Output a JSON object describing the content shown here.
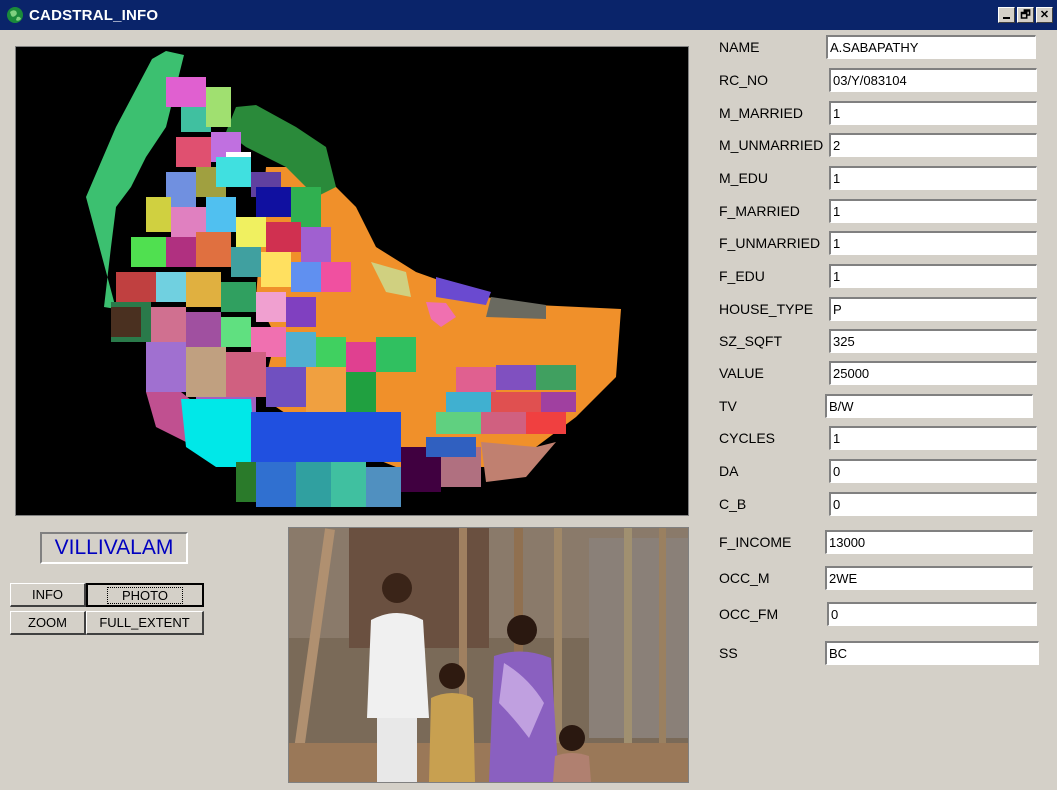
{
  "window": {
    "title": "CADSTRAL_INFO",
    "restore_glyph": "🗗",
    "close_glyph": "✕"
  },
  "village": {
    "name": "VILLIVALAM"
  },
  "buttons": {
    "info": "INFO",
    "photo": "PHOTO",
    "zoom": "ZOOM",
    "full_extent": "FULL_EXTENT"
  },
  "fields": [
    {
      "label": "NAME",
      "value": "A.SABAPATHY"
    },
    {
      "label": "RC_NO",
      "value": "03/Y/083104"
    },
    {
      "label": "M_MARRIED",
      "value": "1"
    },
    {
      "label": "M_UNMARRIED",
      "value": "2"
    },
    {
      "label": "M_EDU",
      "value": "1"
    },
    {
      "label": "F_MARRIED",
      "value": "1"
    },
    {
      "label": "F_UNMARRIED",
      "value": "1"
    },
    {
      "label": "F_EDU",
      "value": "1"
    },
    {
      "label": "HOUSE_TYPE",
      "value": "P"
    },
    {
      "label": "SZ_SQFT",
      "value": "325"
    },
    {
      "label": "VALUE",
      "value": "25000"
    },
    {
      "label": "TV",
      "value": "B/W"
    },
    {
      "label": "CYCLES",
      "value": "1"
    },
    {
      "label": "DA",
      "value": "0"
    },
    {
      "label": "C_B",
      "value": "0"
    },
    {
      "label": "F_INCOME",
      "value": "13000"
    },
    {
      "label": "OCC_M",
      "value": "2WE"
    },
    {
      "label": "OCC_FM",
      "value": "0"
    },
    {
      "label": "SS",
      "value": "BC"
    }
  ],
  "colors": {
    "titlebar": "#0a246a",
    "map_background": "#000000",
    "village_text": "#0000c0",
    "window_face": "#d4d0c8"
  },
  "icons": {
    "app": "globe-icon",
    "minimize": "minimize-icon",
    "restore": "restore-icon",
    "close": "close-icon"
  }
}
